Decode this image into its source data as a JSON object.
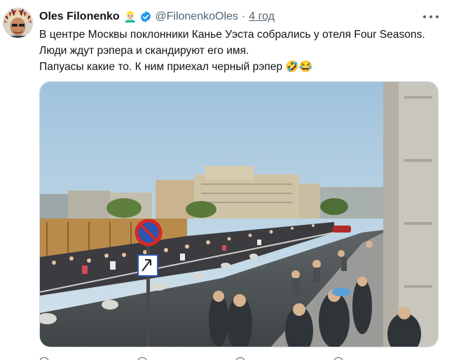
{
  "tweet": {
    "author_name": "Oles Filonenko",
    "author_emoji": "👱🏻‍♂️",
    "handle": "@FilonenkoOles",
    "separator": "·",
    "time": "4 год",
    "text_line1": "В центре Москвы поклонники Канье Уэста собрались у отеля Four Seasons. Люди ждут рэпера и скандируют его имя.",
    "text_line2": "Папуасы какие то. К ним приехал черный рэпер 🤣😂"
  },
  "icons": {
    "verified": "verified-badge-icon",
    "more": "more-options-icon",
    "avatar": "avatar-headdress"
  },
  "colors": {
    "verified": "#1d9bf0",
    "secondary_text": "#536471",
    "primary_text": "#0f1419"
  }
}
